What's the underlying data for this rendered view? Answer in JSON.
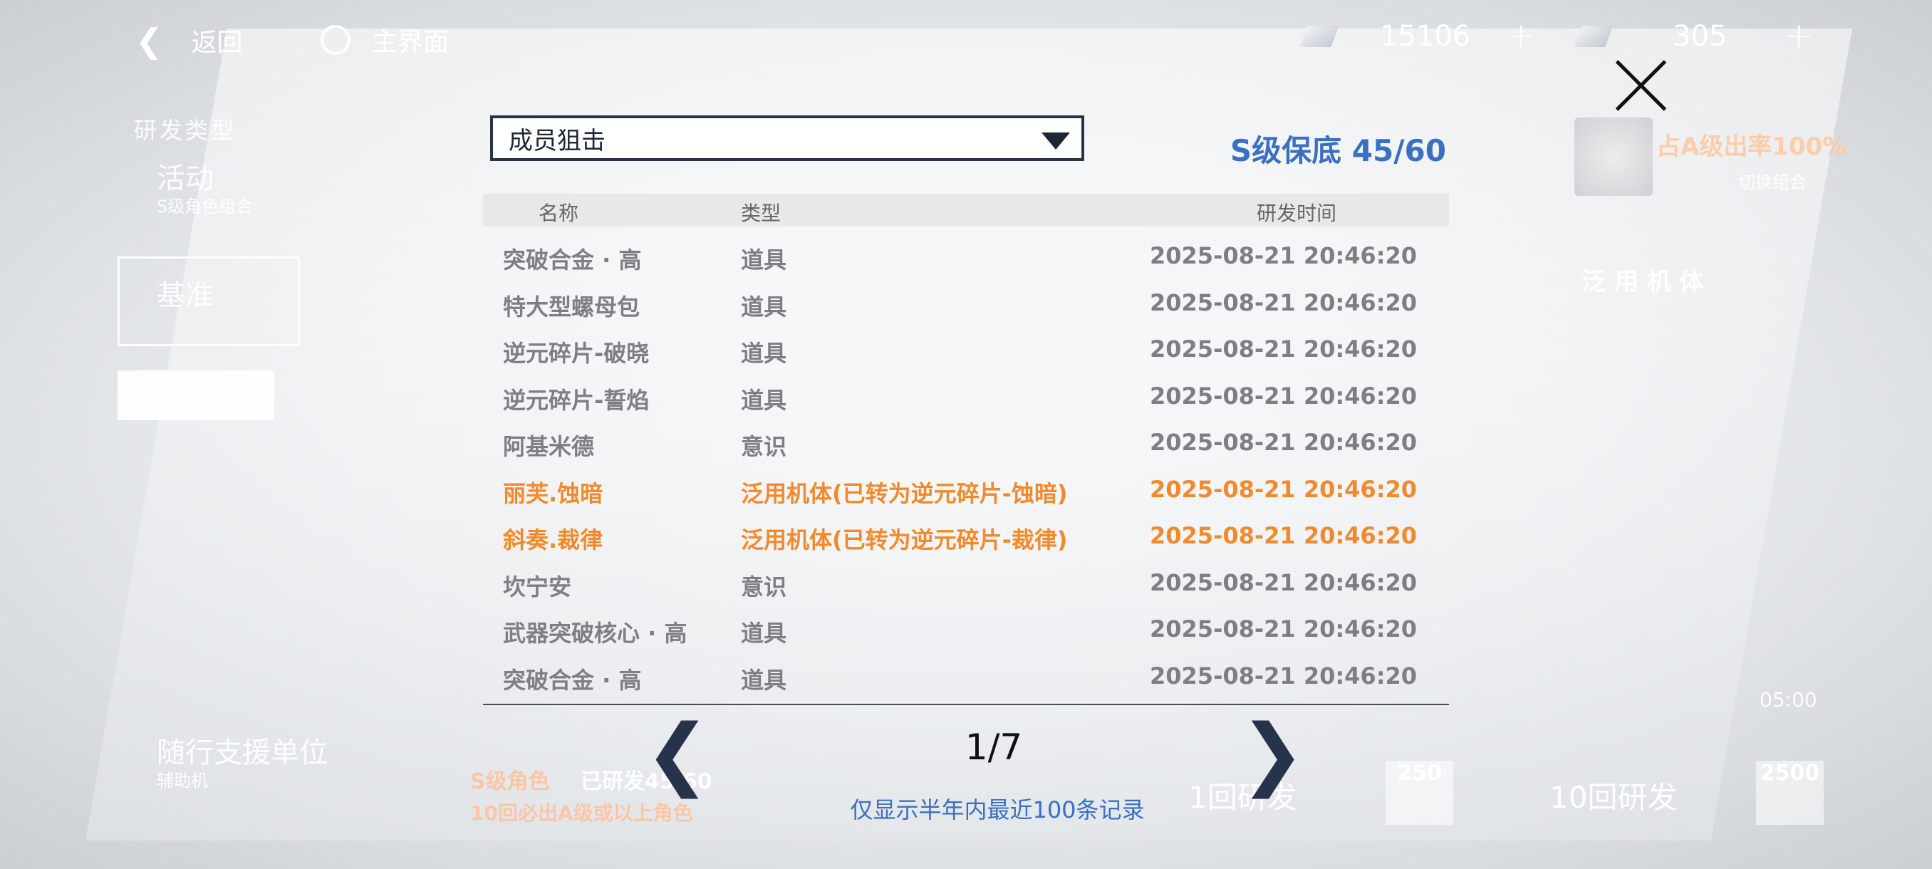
{
  "topbar": {
    "back_label": "返回",
    "home_label": "主界面",
    "resource1_value": "15106",
    "resource2_value": "305",
    "plus": "+"
  },
  "background": {
    "research_type": "研发类型",
    "activity": "活动",
    "activity_sub": "S级角色组合",
    "standard": "基准",
    "support": "随行支援单位",
    "support_sub": "辅助机",
    "rate_text": "占A级出率100%",
    "switch_combo": "切换组合",
    "generic_mech": "泛 用 机 体",
    "bottom_left_line1": "S级角色",
    "bottom_left_line1b": "已研发45/60",
    "bottom_left_line2": "10回必出A级或以上角色",
    "single_research": "1回研发",
    "single_cost": "250",
    "ten_research": "10回研发",
    "ten_cost": "2500",
    "time": "05:00"
  },
  "dialog": {
    "dropdown_value": "成员狙击",
    "pity_text": "S级保底 45/60",
    "headers": {
      "name": "名称",
      "type": "类型",
      "time": "研发时间"
    },
    "rows": [
      {
        "name": "突破合金 · 高",
        "type": "道具",
        "time": "2025-08-21 20:46:20"
      },
      {
        "name": "特大型螺母包",
        "type": "道具",
        "time": "2025-08-21 20:46:20"
      },
      {
        "name": "逆元碎片-破晓",
        "type": "道具",
        "time": "2025-08-21 20:46:20"
      },
      {
        "name": "逆元碎片-誓焰",
        "type": "道具",
        "time": "2025-08-21 20:46:20"
      },
      {
        "name": "阿基米德",
        "type": "意识",
        "time": "2025-08-21 20:46:20"
      },
      {
        "name": "丽芙.蚀暗",
        "type": "泛用机体(已转为逆元碎片-蚀暗)",
        "time": "2025-08-21 20:46:20"
      },
      {
        "name": "斜奏.裁律",
        "type": "泛用机体(已转为逆元碎片-裁律)",
        "time": "2025-08-21 20:46:20"
      },
      {
        "name": "坎宁安",
        "type": "意识",
        "time": "2025-08-21 20:46:20"
      },
      {
        "name": "武器突破核心 · 高",
        "type": "道具",
        "time": "2025-08-21 20:46:20"
      },
      {
        "name": "突破合金 · 高",
        "type": "道具",
        "time": "2025-08-21 20:46:20"
      }
    ],
    "highlight_color": "#f08a2c",
    "normal_color": "#7d7f82",
    "accent_color": "#3a6fc2",
    "page_indicator": "1/7",
    "prev_glyph": "❮",
    "next_glyph": "❯",
    "note": "仅显示半年内最近100条记录"
  }
}
